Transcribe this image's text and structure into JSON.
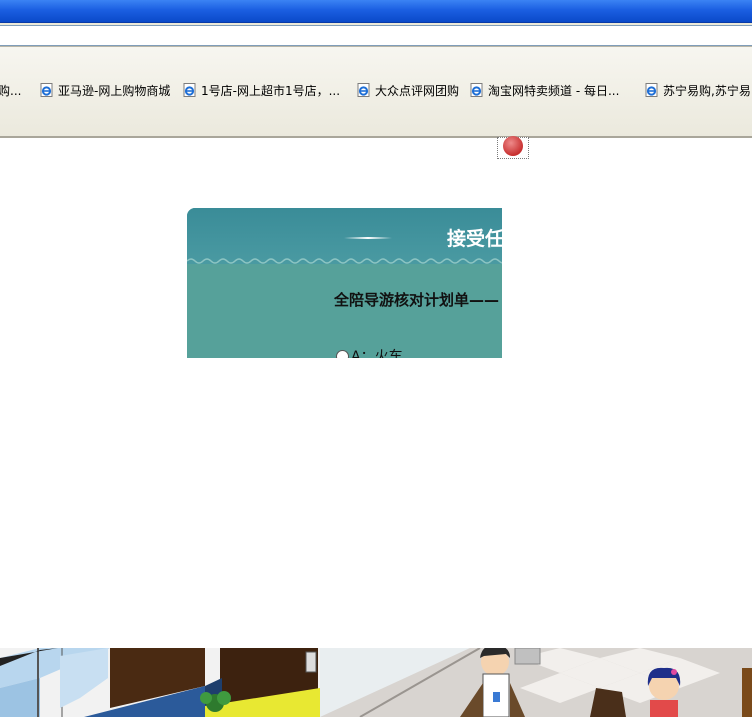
{
  "browser": {
    "links": [
      {
        "label": "购..."
      },
      {
        "label": "亚马逊-网上购物商城"
      },
      {
        "label": "1号店-网上超市1号店，..."
      },
      {
        "label": "大众点评网团购"
      },
      {
        "label": "淘宝网特卖频道 - 每日..."
      },
      {
        "label": "苏宁易购,苏宁易"
      }
    ],
    "icon": "ie-page-icon"
  },
  "game_panel": {
    "title": "接受任",
    "subtitle": "全陪导游核对计划单——",
    "options": [
      {
        "label": "A：火车",
        "selected": false
      }
    ],
    "colors": {
      "header": "#3a8c98",
      "body": "#56a19a",
      "title_text": "#ffffff"
    }
  },
  "close_icon": "close-icon"
}
